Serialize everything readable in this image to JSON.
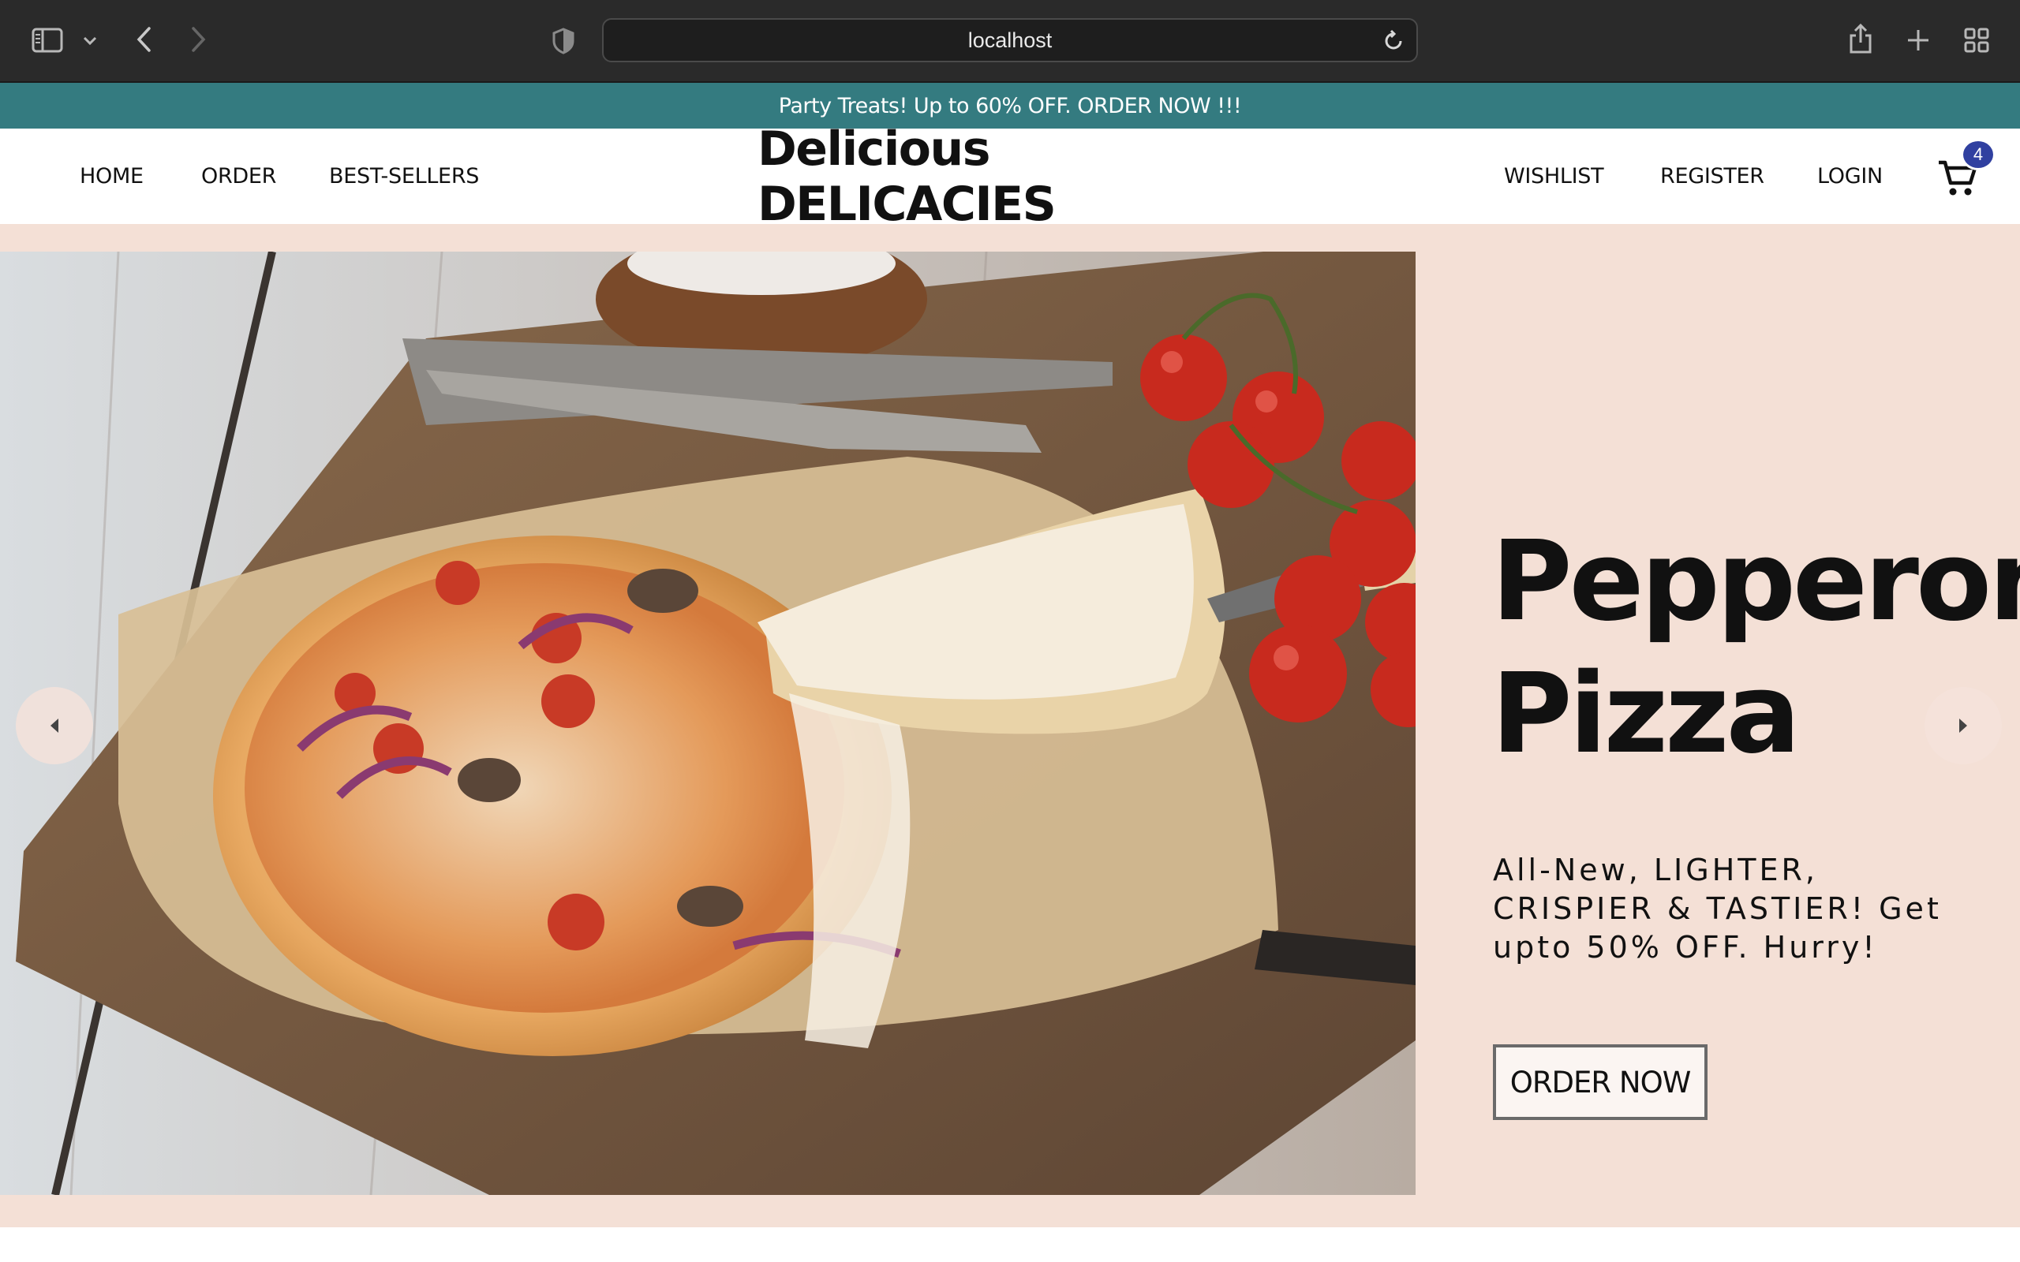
{
  "browser": {
    "url": "localhost",
    "icons": [
      "sidebar-icon",
      "chevron-down-icon",
      "back-icon",
      "forward-icon",
      "shield-icon",
      "reload-icon",
      "share-icon",
      "new-tab-icon",
      "tab-overview-icon"
    ]
  },
  "promo": {
    "text": "Party Treats! Up to 60% OFF. ORDER NOW !!!",
    "bg_color": "#347b80"
  },
  "nav": {
    "left": [
      {
        "label": "HOME"
      },
      {
        "label": "ORDER"
      },
      {
        "label": "BEST-SELLERS"
      }
    ],
    "brand": "Delicious DELICACIES",
    "right": [
      {
        "label": "WISHLIST"
      },
      {
        "label": "REGISTER"
      },
      {
        "label": "LOGIN"
      }
    ],
    "cart_count": "4",
    "badge_color": "#3040a0"
  },
  "hero": {
    "title_line1": "Pepperoni",
    "title_line2": "Pizza",
    "subtitle": "All-New, LIGHTER, CRISPIER & TASTIER! Get upto 50% OFF. Hurry!",
    "cta_label": "ORDER NOW",
    "bg_color": "#f4e0d6",
    "image": "pizza-photo"
  }
}
